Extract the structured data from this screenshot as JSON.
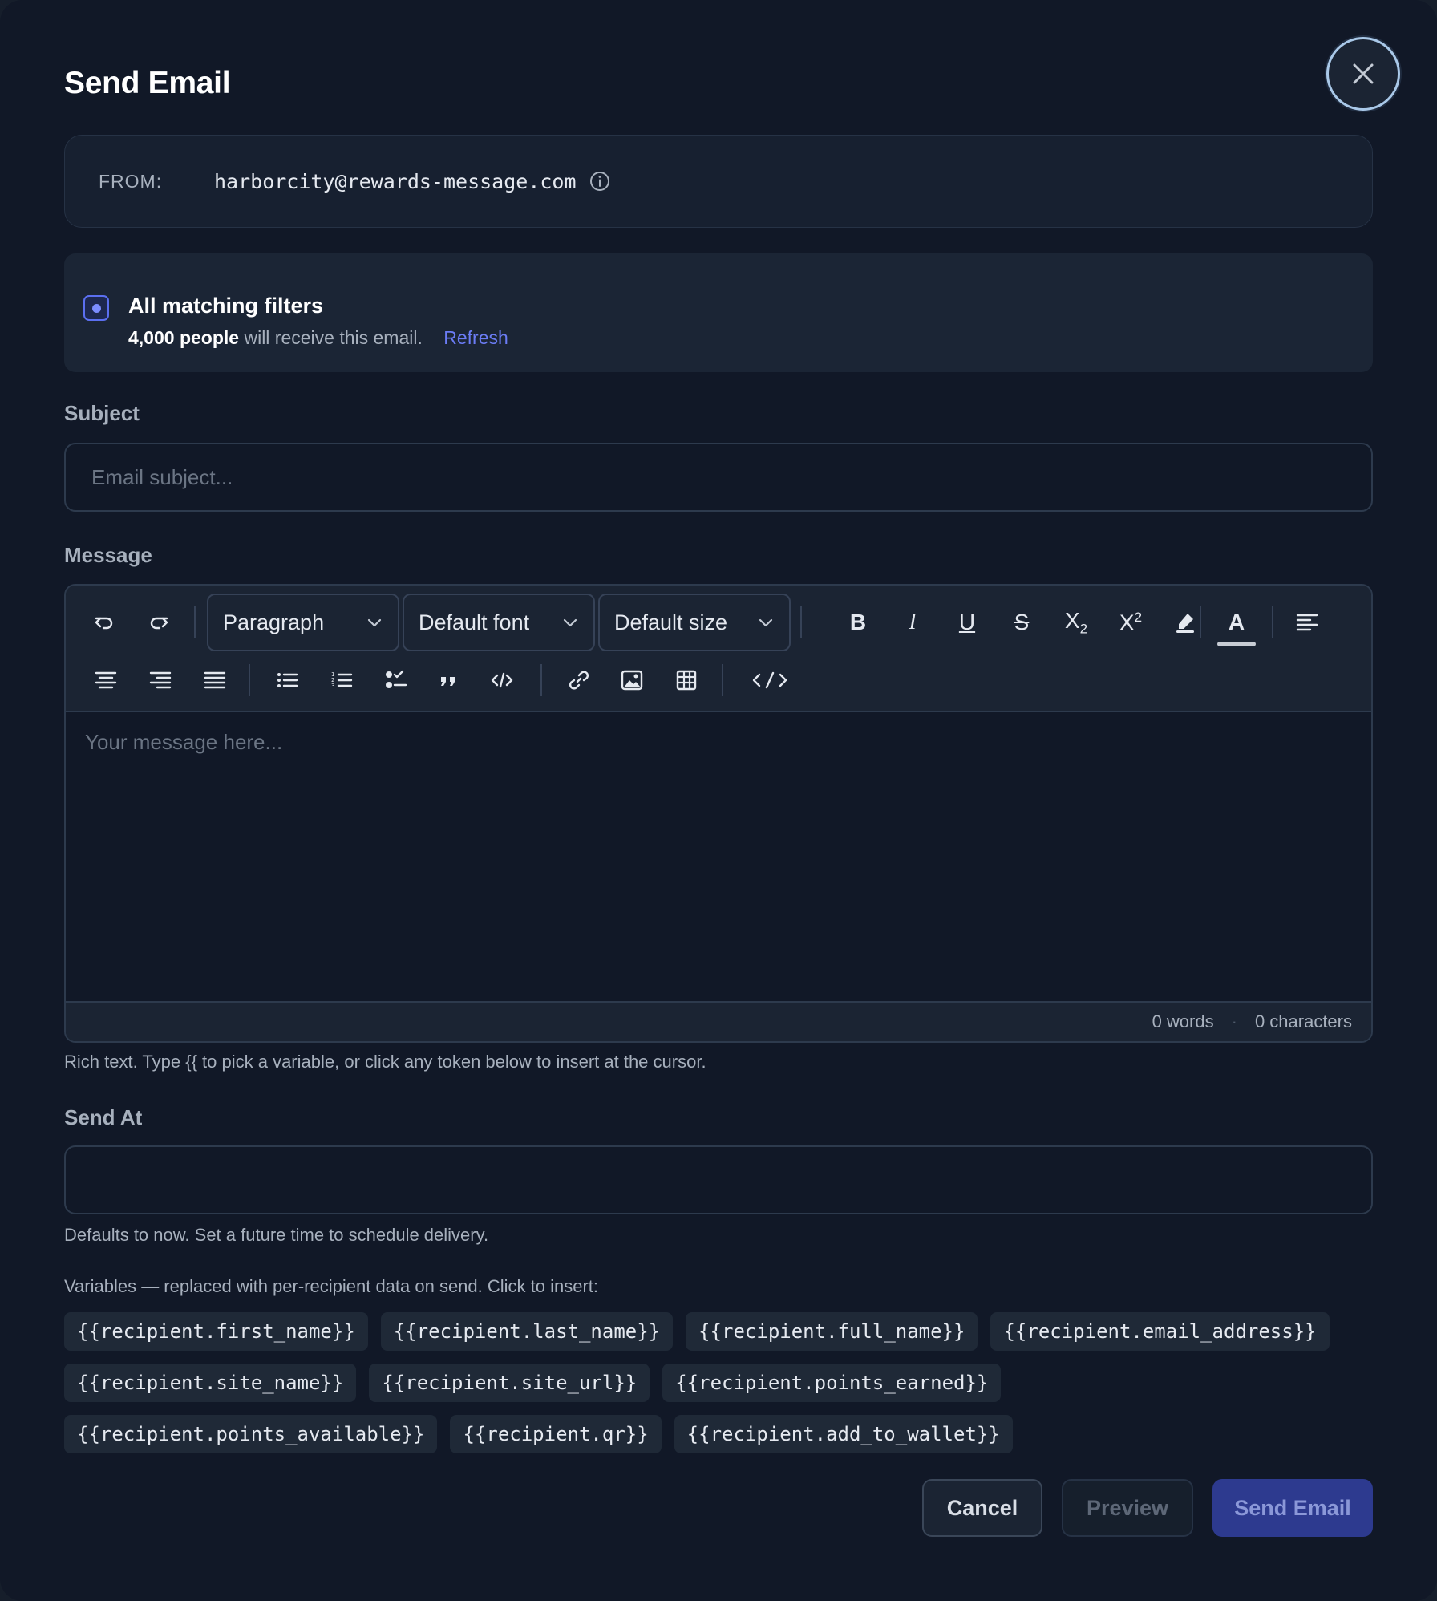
{
  "modal": {
    "title": "Send Email",
    "close_icon": "x-icon"
  },
  "from": {
    "label": "FROM:",
    "address": "harborcity@rewards-message.com",
    "info_icon": "info-circle-icon"
  },
  "recipients": {
    "option_label": "All matching filters",
    "count_text": "4,000 people",
    "suffix_text": "will receive this email.",
    "refresh_label": "Refresh",
    "selected": true
  },
  "subject": {
    "label": "Subject",
    "value": "",
    "placeholder": "Email subject..."
  },
  "message": {
    "label": "Message",
    "placeholder": "Your message here...",
    "block_style": "Paragraph",
    "font": "Default font",
    "size": "Default size",
    "word_count": "0 words",
    "char_count": "0 characters",
    "toolbar_icons": [
      "undo-icon",
      "redo-icon",
      "bold-icon",
      "italic-icon",
      "underline-icon",
      "strikethrough-icon",
      "subscript-icon",
      "superscript-icon",
      "highlight-icon",
      "text-color-icon",
      "align-left-icon",
      "align-center-icon",
      "align-right-icon",
      "align-justify-icon",
      "bullet-list-icon",
      "ordered-list-icon",
      "task-list-icon",
      "blockquote-icon",
      "code-icon",
      "link-icon",
      "image-icon",
      "table-icon",
      "html-source-icon"
    ],
    "help": "Rich text. Type {{ to pick a variable, or click any token below to insert at the cursor."
  },
  "send_at": {
    "label": "Send At",
    "value": "",
    "help": "Defaults to now. Set a future time to schedule delivery."
  },
  "variables": {
    "intro": "Variables — replaced with per-recipient data on send. Click to insert:",
    "rows": [
      [
        "{{recipient.first_name}}",
        "{{recipient.last_name}}",
        "{{recipient.full_name}}",
        "{{recipient.email_address}}"
      ],
      [
        "{{recipient.site_name}}",
        "{{recipient.site_url}}",
        "{{recipient.points_earned}}"
      ],
      [
        "{{recipient.points_available}}",
        "{{recipient.qr}}",
        "{{recipient.add_to_wallet}}"
      ]
    ]
  },
  "actions": {
    "cancel": "Cancel",
    "preview": "Preview",
    "send": "Send Email"
  },
  "colors": {
    "background": "#111827",
    "panel": "#1b2433",
    "accent": "#5b6ff0",
    "link": "#6b7cf5",
    "send_button": "#2d3a8f"
  }
}
